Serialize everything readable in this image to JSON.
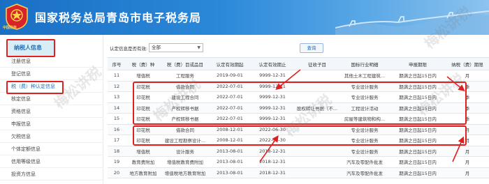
{
  "header": {
    "title": "国家税务总局青岛市电子税务局",
    "logo_text": "中国税务"
  },
  "sidebar": {
    "heading": "纳税人信息",
    "items": [
      {
        "label": "注册信息"
      },
      {
        "label": "登记信息"
      },
      {
        "label": "税（费）种认定信息"
      },
      {
        "label": "核定信息"
      },
      {
        "label": "资格信息"
      },
      {
        "label": "申报信息"
      },
      {
        "label": "欠税信息"
      },
      {
        "label": "个体定额信息"
      },
      {
        "label": "信用等级信息"
      },
      {
        "label": "投资方信息"
      }
    ]
  },
  "filter": {
    "label": "认定信息是否有效:",
    "select_value": "全部",
    "query_label": "查询"
  },
  "table": {
    "headers": [
      "序号",
      "税（费）种",
      "税（费）目或品目",
      "认定有效期起",
      "认定有效期止",
      "征收子目",
      "国标行业明细",
      "申报期限",
      "纳税（费）期限"
    ],
    "rows": [
      [
        "11",
        "增值税",
        "工程服务",
        "2019-09-01",
        "9999-12-31",
        "",
        "其他土木工程建筑...",
        "期满之日起15日内",
        "月"
      ],
      [
        "12",
        "印花税",
        "借款合同",
        "2022-07-01",
        "9999-12-31",
        "",
        "专业设计服务",
        "期满之日起15日内",
        "季"
      ],
      [
        "13",
        "印花税",
        "建设工程合同",
        "2022-07-01",
        "9999-12-31",
        "",
        "专业设计服务",
        "期满之日起15日内",
        "季"
      ],
      [
        "14",
        "印花税",
        "产权转移书据",
        "2022-07-01",
        "9999-12-31",
        "股权转让书据（不...",
        "工程设计活动",
        "期满之日起15日内",
        "季"
      ],
      [
        "15",
        "印花税",
        "产权转移书据",
        "2022-07-01",
        "9999-12-31",
        "",
        "房屋等建筑物和构...",
        "期满之日起15日内",
        "季"
      ],
      [
        "16",
        "印花税",
        "借款合同",
        "2008-12-01",
        "2022-06-30",
        "",
        "专业设计服务",
        "期满之日起15日内",
        "月"
      ],
      [
        "17",
        "印花税",
        "建设工程勘察设计...",
        "2008-12-01",
        "2022-06-30",
        "",
        "专业设计服务",
        "期满之日起15日内",
        "月"
      ],
      [
        "18",
        "增值税",
        "设计服务",
        "2013-08-01",
        "2018-12-31",
        "",
        "专业设计服务",
        "期满之日起15日内",
        "月"
      ],
      [
        "19",
        "教育费附加",
        "增值税教育费附加",
        "2013-08-01",
        "2018-12-31",
        "",
        "汽车及零配件批发",
        "期满之日起15日内",
        "月"
      ],
      [
        "20",
        "地方教育附加",
        "增值税地方教育附加",
        "2013-08-01",
        "2018-12-31",
        "",
        "汽车及零配件批发",
        "期满之日起15日内",
        "月"
      ]
    ]
  },
  "watermark": "梅松讲税",
  "colors": {
    "header_start": "#1a6fc4",
    "accent": "#1f6eb8",
    "highlight_border": "#e02020"
  }
}
